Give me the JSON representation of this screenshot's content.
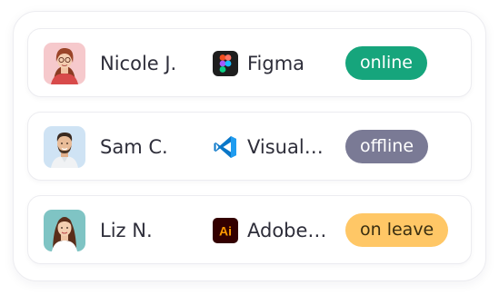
{
  "members": [
    {
      "name": "Nicole J.",
      "app_icon": "figma-icon",
      "app_name": "Figma",
      "status": "online",
      "status_bg": "#16a57c",
      "status_fg": "#ffffff"
    },
    {
      "name": "Sam C.",
      "app_icon": "vscode-icon",
      "app_name": "Visual…",
      "status": "offline",
      "status_bg": "#7a7a95",
      "status_fg": "#ffffff"
    },
    {
      "name": "Liz N.",
      "app_icon": "adobe-illustrator-icon",
      "app_name": "Adobe…",
      "status": "on leave",
      "status_bg": "#ffc766",
      "status_fg": "#3a2e10"
    }
  ],
  "colors": {
    "card_border": "#ececf0",
    "text": "#2e2e3a"
  }
}
